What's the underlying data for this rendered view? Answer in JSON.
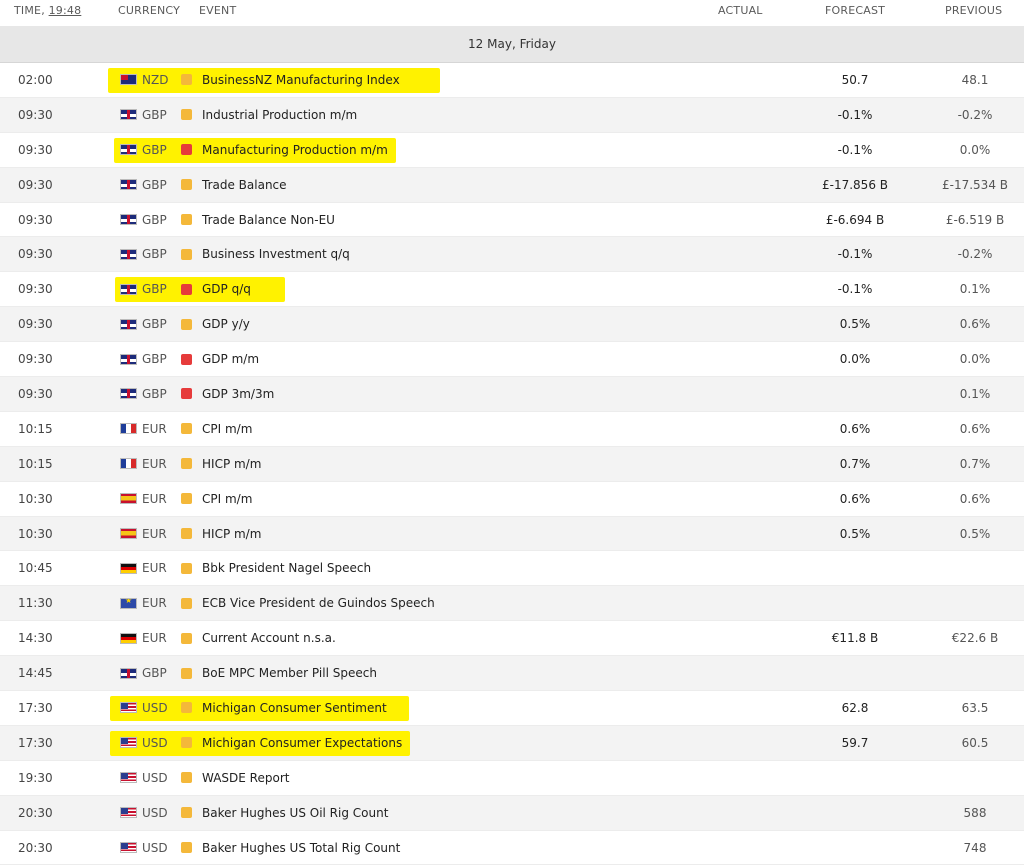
{
  "header": {
    "time_label": "TIME,",
    "clock": "19:48",
    "currency": "CURRENCY",
    "event": "EVENT",
    "actual": "ACTUAL",
    "forecast": "FORECAST",
    "previous": "PREVIOUS"
  },
  "day": "12 May, Friday",
  "colors": {
    "highlight": "#fff200",
    "importance_medium": "#f4b83a",
    "importance_high": "#e63b3b",
    "day_bar": "#e7e7e7"
  },
  "events": [
    {
      "time": "02:00",
      "flag": "nzd-flag-icon",
      "flag_class": "f-nzd",
      "currency": "NZD",
      "importance": "medium",
      "event": "BusinessNZ Manufacturing Index",
      "actual": "",
      "forecast": "50.7",
      "previous": "48.1",
      "highlight": true
    },
    {
      "time": "09:30",
      "flag": "gbp-flag-icon",
      "flag_class": "f-gbp",
      "currency": "GBP",
      "importance": "medium",
      "event": "Industrial Production m/m",
      "actual": "",
      "forecast": "-0.1%",
      "previous": "-0.2%",
      "highlight": false
    },
    {
      "time": "09:30",
      "flag": "gbp-flag-icon",
      "flag_class": "f-gbp",
      "currency": "GBP",
      "importance": "high",
      "event": "Manufacturing Production m/m",
      "actual": "",
      "forecast": "-0.1%",
      "previous": "0.0%",
      "highlight": true
    },
    {
      "time": "09:30",
      "flag": "gbp-flag-icon",
      "flag_class": "f-gbp",
      "currency": "GBP",
      "importance": "medium",
      "event": "Trade Balance",
      "actual": "",
      "forecast": "£-17.856 B",
      "previous": "£-17.534 B",
      "highlight": false
    },
    {
      "time": "09:30",
      "flag": "gbp-flag-icon",
      "flag_class": "f-gbp",
      "currency": "GBP",
      "importance": "medium",
      "event": "Trade Balance Non-EU",
      "actual": "",
      "forecast": "£-6.694 B",
      "previous": "£-6.519 B",
      "highlight": false
    },
    {
      "time": "09:30",
      "flag": "gbp-flag-icon",
      "flag_class": "f-gbp",
      "currency": "GBP",
      "importance": "medium",
      "event": "Business Investment q/q",
      "actual": "",
      "forecast": "-0.1%",
      "previous": "-0.2%",
      "highlight": false
    },
    {
      "time": "09:30",
      "flag": "gbp-flag-icon",
      "flag_class": "f-gbp",
      "currency": "GBP",
      "importance": "high",
      "event": "GDP q/q",
      "actual": "",
      "forecast": "-0.1%",
      "previous": "0.1%",
      "highlight": true
    },
    {
      "time": "09:30",
      "flag": "gbp-flag-icon",
      "flag_class": "f-gbp",
      "currency": "GBP",
      "importance": "medium",
      "event": "GDP y/y",
      "actual": "",
      "forecast": "0.5%",
      "previous": "0.6%",
      "highlight": false
    },
    {
      "time": "09:30",
      "flag": "gbp-flag-icon",
      "flag_class": "f-gbp",
      "currency": "GBP",
      "importance": "high",
      "event": "GDP m/m",
      "actual": "",
      "forecast": "0.0%",
      "previous": "0.0%",
      "highlight": false
    },
    {
      "time": "09:30",
      "flag": "gbp-flag-icon",
      "flag_class": "f-gbp",
      "currency": "GBP",
      "importance": "high",
      "event": "GDP 3m/3m",
      "actual": "",
      "forecast": "",
      "previous": "0.1%",
      "highlight": false
    },
    {
      "time": "10:15",
      "flag": "france-flag-icon",
      "flag_class": "f-fr",
      "currency": "EUR",
      "importance": "medium",
      "event": "CPI m/m",
      "actual": "",
      "forecast": "0.6%",
      "previous": "0.6%",
      "highlight": false
    },
    {
      "time": "10:15",
      "flag": "france-flag-icon",
      "flag_class": "f-fr",
      "currency": "EUR",
      "importance": "medium",
      "event": "HICP m/m",
      "actual": "",
      "forecast": "0.7%",
      "previous": "0.7%",
      "highlight": false
    },
    {
      "time": "10:30",
      "flag": "spain-flag-icon",
      "flag_class": "f-es",
      "currency": "EUR",
      "importance": "medium",
      "event": "CPI m/m",
      "actual": "",
      "forecast": "0.6%",
      "previous": "0.6%",
      "highlight": false
    },
    {
      "time": "10:30",
      "flag": "spain-flag-icon",
      "flag_class": "f-es",
      "currency": "EUR",
      "importance": "medium",
      "event": "HICP m/m",
      "actual": "",
      "forecast": "0.5%",
      "previous": "0.5%",
      "highlight": false
    },
    {
      "time": "10:45",
      "flag": "germany-flag-icon",
      "flag_class": "f-de",
      "currency": "EUR",
      "importance": "medium",
      "event": "Bbk President Nagel Speech",
      "actual": "",
      "forecast": "",
      "previous": "",
      "highlight": false
    },
    {
      "time": "11:30",
      "flag": "eu-flag-icon",
      "flag_class": "f-eu",
      "currency": "EUR",
      "importance": "medium",
      "event": "ECB Vice President de Guindos Speech",
      "actual": "",
      "forecast": "",
      "previous": "",
      "highlight": false
    },
    {
      "time": "14:30",
      "flag": "germany-flag-icon",
      "flag_class": "f-de",
      "currency": "EUR",
      "importance": "medium",
      "event": "Current Account n.s.a.",
      "actual": "",
      "forecast": "€11.8 B",
      "previous": "€22.6 B",
      "highlight": false
    },
    {
      "time": "14:45",
      "flag": "gbp-flag-icon",
      "flag_class": "f-gbp",
      "currency": "GBP",
      "importance": "medium",
      "event": "BoE MPC Member Pill Speech",
      "actual": "",
      "forecast": "",
      "previous": "",
      "highlight": false
    },
    {
      "time": "17:30",
      "flag": "usa-flag-icon",
      "flag_class": "f-us",
      "currency": "USD",
      "importance": "medium",
      "event": "Michigan Consumer Sentiment",
      "actual": "",
      "forecast": "62.8",
      "previous": "63.5",
      "highlight": true
    },
    {
      "time": "17:30",
      "flag": "usa-flag-icon",
      "flag_class": "f-us",
      "currency": "USD",
      "importance": "medium",
      "event": "Michigan Consumer Expectations",
      "actual": "",
      "forecast": "59.7",
      "previous": "60.5",
      "highlight": true
    },
    {
      "time": "19:30",
      "flag": "usa-flag-icon",
      "flag_class": "f-us",
      "currency": "USD",
      "importance": "medium",
      "event": "WASDE Report",
      "actual": "",
      "forecast": "",
      "previous": "",
      "highlight": false
    },
    {
      "time": "20:30",
      "flag": "usa-flag-icon",
      "flag_class": "f-us",
      "currency": "USD",
      "importance": "medium",
      "event": "Baker Hughes US Oil Rig Count",
      "actual": "",
      "forecast": "",
      "previous": "588",
      "highlight": false
    },
    {
      "time": "20:30",
      "flag": "usa-flag-icon",
      "flag_class": "f-us",
      "currency": "USD",
      "importance": "medium",
      "event": "Baker Hughes US Total Rig Count",
      "actual": "",
      "forecast": "",
      "previous": "748",
      "highlight": false
    }
  ]
}
